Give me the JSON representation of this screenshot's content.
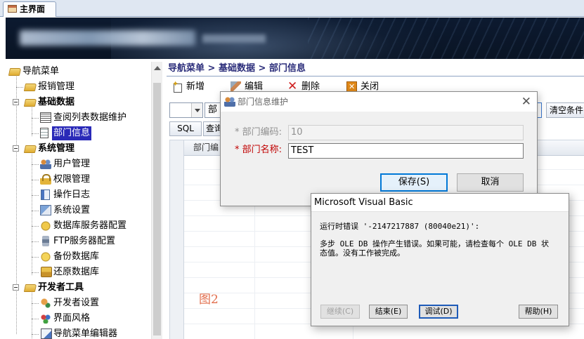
{
  "tab": {
    "label": "主界面"
  },
  "nav": {
    "items": [
      {
        "label": "导航菜单"
      },
      {
        "label": "报销管理"
      },
      {
        "label": "基础数据"
      },
      {
        "label": "查阅列表数据维护"
      },
      {
        "label": "部门信息"
      },
      {
        "label": "系统管理"
      },
      {
        "label": "用户管理"
      },
      {
        "label": "权限管理"
      },
      {
        "label": "操作日志"
      },
      {
        "label": "系统设置"
      },
      {
        "label": "数据库服务器配置"
      },
      {
        "label": "FTP服务器配置"
      },
      {
        "label": "备份数据库"
      },
      {
        "label": "还原数据库"
      },
      {
        "label": "开发者工具"
      },
      {
        "label": "开发者设置"
      },
      {
        "label": "界面风格"
      },
      {
        "label": "导航菜单编辑器"
      }
    ]
  },
  "content": {
    "breadcrumb": "导航菜单 > 基础数据 > 部门信息",
    "toolbar": {
      "new": "新增",
      "edit": "编辑",
      "delete": "删除",
      "close": "关闭"
    },
    "filter": {
      "field": "部",
      "clear": "清空条件"
    },
    "sql_button": "SQL",
    "query_button": "查询",
    "grid": {
      "col1": "部门编"
    },
    "fig_label": "图2"
  },
  "dept_dialog": {
    "title": "部门信息维护",
    "code_label": "* 部门编码:",
    "code_value": "10",
    "name_label": "* 部门名称:",
    "name_value": "TEST",
    "save": "保存(S)",
    "cancel": "取消"
  },
  "vb_dialog": {
    "title": "Microsoft Visual Basic",
    "error_line": "运行时错误 '-2147217887 (80040e21)':",
    "message": "多步 OLE DB 操作产生错误。如果可能，请检查每个 OLE DB 状\n态值。没有工作被完成。",
    "buttons": {
      "continue": "继续(C)",
      "end": "结束(E)",
      "debug": "调试(D)",
      "help": "帮助(H)"
    }
  },
  "colors": {
    "selected_bg": "#2a2ab8",
    "breadcrumb": "#2b2d7a",
    "required": "#c00000",
    "figure_label": "#e26f4e"
  }
}
